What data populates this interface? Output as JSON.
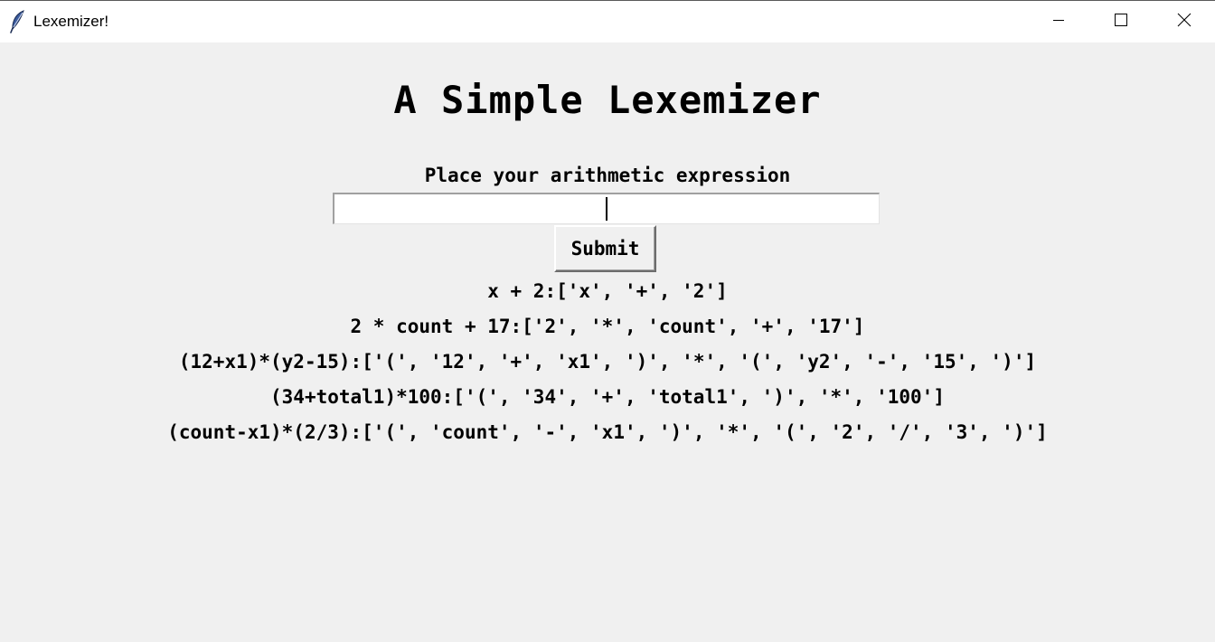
{
  "window": {
    "title": "Lexemizer!",
    "icon": "feather-icon",
    "controls": [
      "minimize-icon",
      "maximize-icon",
      "close-icon"
    ]
  },
  "main": {
    "heading": "A Simple Lexemizer",
    "prompt": "Place your arithmetic expression",
    "input": {
      "value": "",
      "placeholder": ""
    },
    "submit_label": "Submit",
    "results": [
      "x + 2:['x', '+', '2']",
      "2 * count + 17:['2', '*', 'count', '+', '17']",
      "(12+x1)*(y2-15):['(', '12', '+', 'x1', ')', '*', '(', 'y2', '-', '15', ')']",
      "(34+total1)*100:['(', '34', '+', 'total1', ')', '*', '100']",
      "(count-x1)*(2/3):['(', 'count', '-', 'x1', ')', '*', '(', '2', '/', '3', ')']"
    ]
  }
}
